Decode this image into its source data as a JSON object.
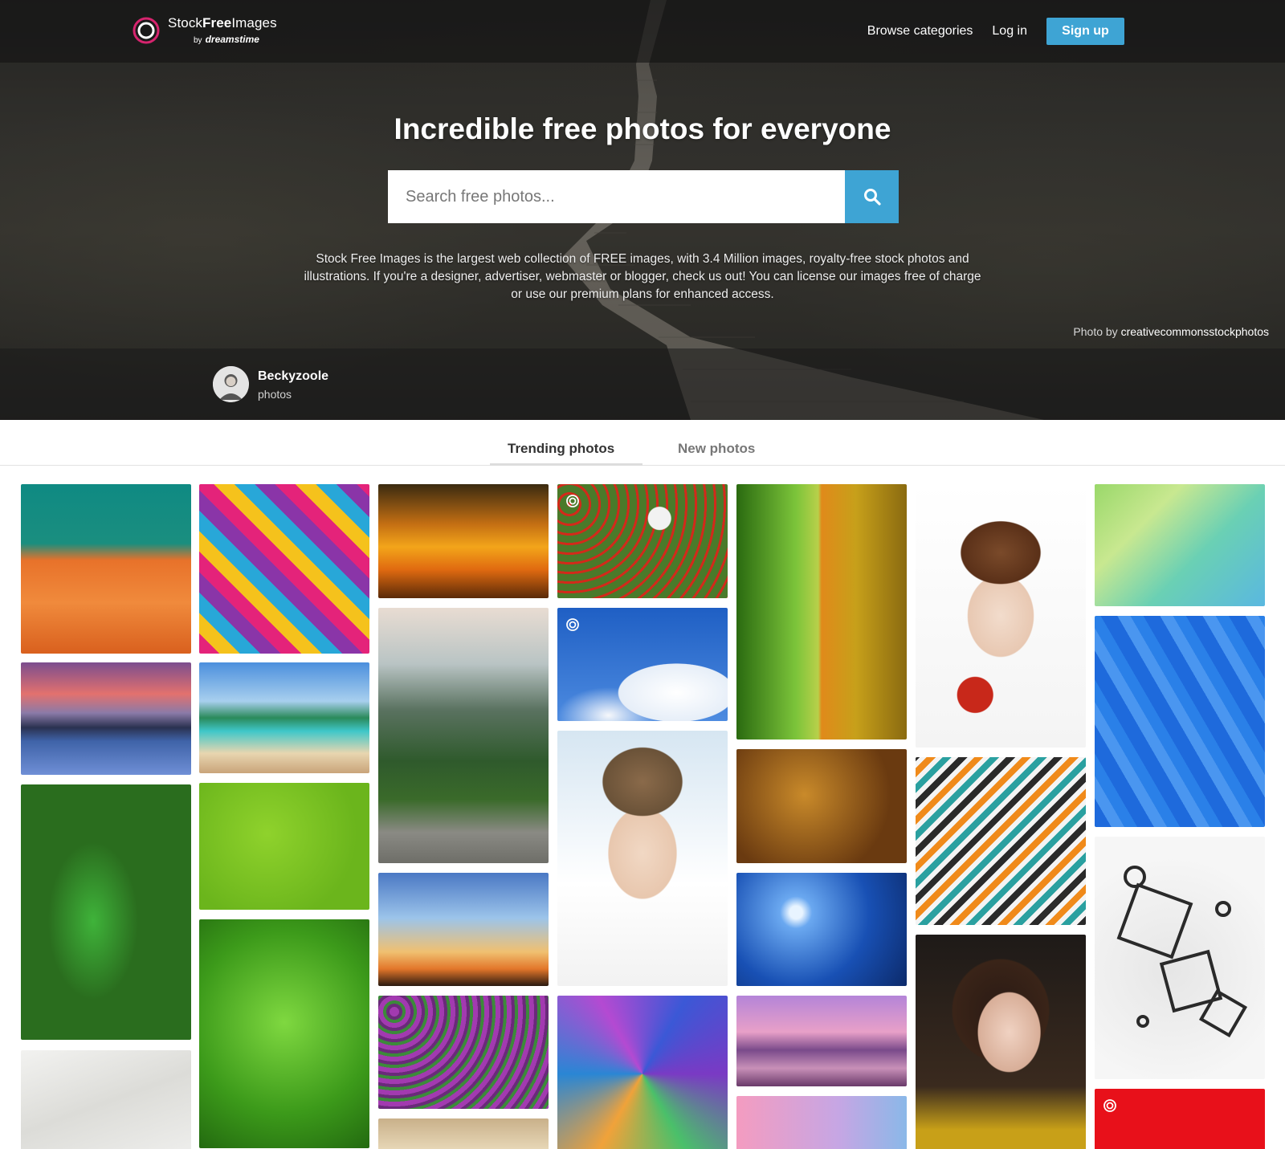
{
  "header": {
    "logo_name_plain": "Stock",
    "logo_name_bold": "Free",
    "logo_name_end": "Images",
    "logo_by": "by",
    "logo_brand": "dreamstime",
    "nav": {
      "browse": "Browse categories",
      "login": "Log in",
      "signup": "Sign up"
    }
  },
  "hero": {
    "headline": "Incredible free photos for everyone",
    "search_placeholder": "Search free photos...",
    "intro": "Stock Free Images is the largest web collection of FREE images, with 3.4 Million images, royalty-free stock photos and illustrations. If you're a designer, advertiser, webmaster or blogger, check us out! You can license our images free of charge or use our premium plans for enhanced access.",
    "credit_prefix": "Photo by",
    "credit_author": "creativecommonsstockphotos"
  },
  "author": {
    "name": "Beckyzoole",
    "sub": "photos"
  },
  "tabs": {
    "trending": "Trending photos",
    "new": "New photos"
  },
  "colors": {
    "accent": "#3ea4d4",
    "logo_ring": "#d6246e"
  },
  "icons": {
    "search": "search-icon",
    "logo": "logo-icon",
    "avatar": "user-avatar",
    "badge": "spiral-badge-icon"
  }
}
